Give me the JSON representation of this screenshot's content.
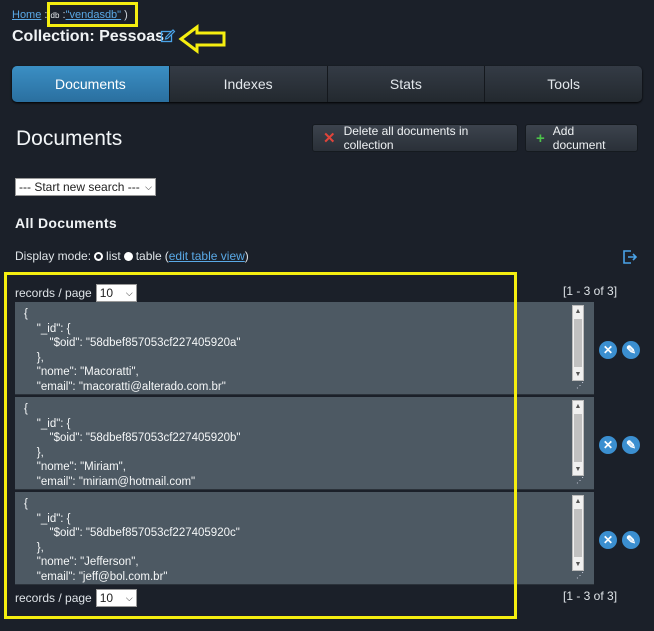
{
  "breadcrumb": {
    "home": "Home",
    "sep": ":",
    "db_label": "db",
    "colon": ":",
    "db_name": "\"vendasdb\"",
    "close": ")"
  },
  "title": "Collection: Pessoas",
  "tabs": [
    {
      "label": "Documents",
      "active": true
    },
    {
      "label": "Indexes"
    },
    {
      "label": "Stats"
    },
    {
      "label": "Tools"
    }
  ],
  "heading": "Documents",
  "buttons": {
    "delete_all": "Delete all documents in collection",
    "add": "Add document"
  },
  "search_select": "--- Start new search ---",
  "all_documents": "All Documents",
  "display_mode": {
    "label": "Display mode:",
    "list": "list",
    "table": "table",
    "edit_open": "(",
    "edit_link": "edit table view",
    "edit_close": ")"
  },
  "records_per_page": {
    "label": "records / page",
    "value": "10"
  },
  "range": "[1 - 3 of 3]",
  "documents": [
    {
      "text": "{\n    \"_id\": {\n        \"$oid\": \"58dbef857053cf227405920a\"\n    },\n    \"nome\": \"Macoratti\",\n    \"email\": \"macoratti@alterado.com.br\"\n}"
    },
    {
      "text": "{\n    \"_id\": {\n        \"$oid\": \"58dbef857053cf227405920b\"\n    },\n    \"nome\": \"Miriam\",\n    \"email\": \"miriam@hotmail.com\"\n}"
    },
    {
      "text": "{\n    \"_id\": {\n        \"$oid\": \"58dbef857053cf227405920c\"\n    },\n    \"nome\": \"Jefferson\",\n    \"email\": \"jeff@bol.com.br\"\n}"
    }
  ],
  "colors": {
    "accent": "#3b8fc4",
    "highlight": "#f5ee10",
    "background": "#1b2029"
  }
}
